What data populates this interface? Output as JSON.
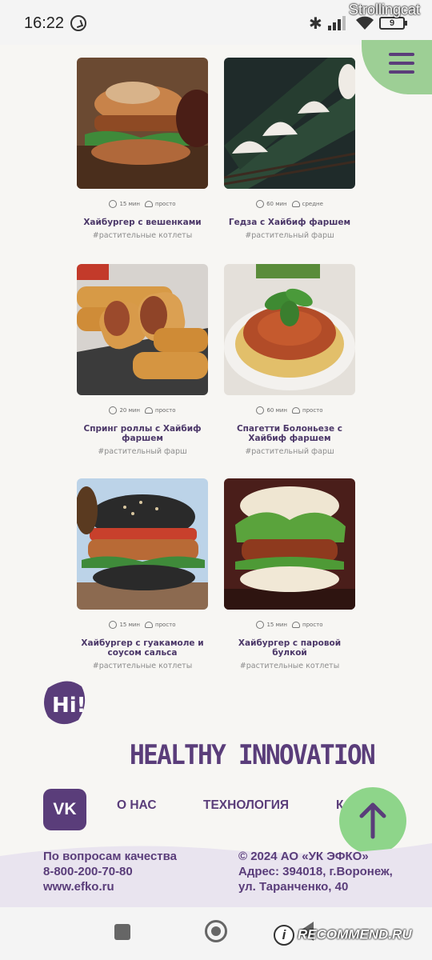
{
  "status_bar": {
    "time": "16:22",
    "battery": "9",
    "watermark_top": "Strollingcat"
  },
  "recipes": [
    {
      "time": "15 мин",
      "difficulty": "просто",
      "title": "Хайбургер с вешенками",
      "tag": "#растительные котлеты"
    },
    {
      "time": "60 мин",
      "difficulty": "средне",
      "title": "Гедза с Хайбиф фаршем",
      "tag": "#растительный фарш"
    },
    {
      "time": "20 мин",
      "difficulty": "просто",
      "title": "Спринг роллы с Хайбиф фаршем",
      "tag": "#растительный фарш"
    },
    {
      "time": "60 мин",
      "difficulty": "просто",
      "title": "Спагетти Болоньезе с Хайбиф фаршем",
      "tag": "#растительный фарш"
    },
    {
      "time": "15 мин",
      "difficulty": "просто",
      "title": "Хайбургер с гуакамоле и соусом сальса",
      "tag": "#растительные котлеты"
    },
    {
      "time": "15 мин",
      "difficulty": "просто",
      "title": "Хайбургер с паровой булкой",
      "tag": "#растительные котлеты"
    }
  ],
  "footer": {
    "logo_text": "Hi!",
    "slogan": "HEALTHY INNOVATION",
    "vk_label": "VK",
    "nav": [
      "О НАС",
      "ТЕХНОЛОГИЯ",
      "К"
    ],
    "quality_title": "По вопросам качества",
    "phone": "8-800-200-70-80",
    "website": "www.efko.ru",
    "copyright": "© 2024 АО «УК ЭФКО»",
    "address_line1": "Адрес: 394018, г.Воронеж,",
    "address_line2": "ул. Таранченко, 40"
  },
  "watermark_bottom": "RECOMMEND.RU",
  "watermark_mark": "i",
  "colors": {
    "brand_purple": "#5a3d7a",
    "accent_green": "#8ed58a",
    "background": "#f7f6f3"
  }
}
